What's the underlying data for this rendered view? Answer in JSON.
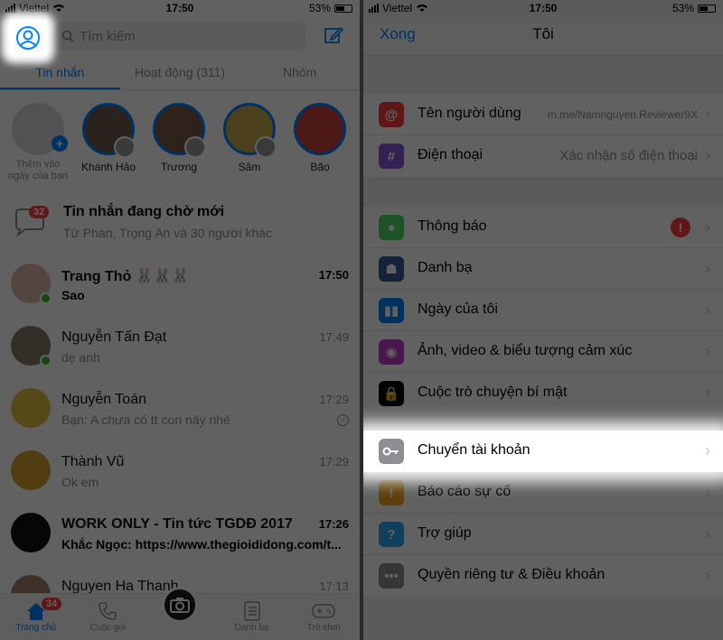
{
  "left": {
    "status": {
      "carrier": "Viettel",
      "time": "17:50",
      "battery": "53%"
    },
    "search": {
      "placeholder": "Tìm kiếm"
    },
    "tabs": [
      {
        "label": "Tin nhắn",
        "active": true
      },
      {
        "label": "Hoạt động (311)",
        "active": false
      },
      {
        "label": "Nhóm",
        "active": false
      }
    ],
    "stories": [
      {
        "label": "Thêm vào ngày của bạn",
        "add": true
      },
      {
        "label": "Khánh Hảo"
      },
      {
        "label": "Trương"
      },
      {
        "label": "Sâm"
      },
      {
        "label": "Bão"
      }
    ],
    "pending": {
      "badge": "32",
      "title": "Tin nhắn đang chờ mới",
      "subtitle": "Từ Phan, Trọng An và 30 người khác"
    },
    "conversations": [
      {
        "name": "Trang Thỏ 🐰🐰🐰",
        "message": "Sao",
        "time": "17:50",
        "unread": true,
        "online": true
      },
      {
        "name": "Nguyễn Tấn Đạt",
        "message": "dẹ anh",
        "time": "17:49",
        "unread": false,
        "online": true
      },
      {
        "name": "Nguyễn Toán",
        "message": "Bạn: A chưa có tt con này nhé",
        "time": "17:29",
        "unread": false,
        "online": false,
        "seen": true
      },
      {
        "name": "Thành Vũ",
        "message": "Ok em",
        "time": "17:29",
        "unread": false,
        "online": false
      },
      {
        "name": "WORK ONLY - Tin tức TGDĐ 2017",
        "message": "Khắc Ngọc: https://www.thegioididong.com/t...",
        "time": "17:26",
        "unread": true,
        "online": false
      },
      {
        "name": "Nguyen Ha Thanh",
        "message": "",
        "time": "17:13",
        "unread": false,
        "online": false
      }
    ],
    "tabbar": [
      {
        "label": "Trang chủ",
        "badge": "34",
        "active": true,
        "icon": "home-icon"
      },
      {
        "label": "Cuộc gọi",
        "icon": "phone-icon"
      },
      {
        "label": "",
        "icon": "camera-icon"
      },
      {
        "label": "Danh bạ",
        "icon": "contacts-icon"
      },
      {
        "label": "Trò chơi",
        "icon": "game-icon"
      }
    ]
  },
  "right": {
    "status": {
      "carrier": "Viettel",
      "time": "17:50",
      "battery": "53%"
    },
    "nav": {
      "done": "Xong",
      "title": "Tôi"
    },
    "group1": [
      {
        "label": "Tên người dùng",
        "value": "m.me/Namnguyen.Reviewer9X",
        "color": "#fa3e3e",
        "icon": "at-icon"
      },
      {
        "label": "Điện thoại",
        "value": "Xác nhận số điện thoại",
        "color": "#8a58d6",
        "icon": "hash-icon"
      }
    ],
    "group2": [
      {
        "label": "Thông báo",
        "alert": "!",
        "color": "#4cd964",
        "icon": "notification-icon"
      },
      {
        "label": "Danh bạ",
        "color": "#3b5998",
        "icon": "people-icon"
      },
      {
        "label": "Ngày của tôi",
        "color": "#0084ff",
        "icon": "day-icon"
      },
      {
        "label": "Ảnh, video & biểu tượng cảm xúc",
        "color": "#c43ac7",
        "icon": "camera-icon"
      },
      {
        "label": "Cuộc trò chuyện bí mật",
        "color": "#000000",
        "icon": "lock-icon"
      }
    ],
    "highlight": {
      "label": "Chuyển tài khoản",
      "color": "#8e8e93",
      "icon": "key-icon"
    },
    "group3": [
      {
        "label": "Báo cáo sự cố",
        "color": "#f5a623",
        "icon": "warning-icon"
      },
      {
        "label": "Trợ giúp",
        "color": "#2aa8f5",
        "icon": "help-icon"
      },
      {
        "label": "Quyền riêng tư & Điều khoản",
        "color": "#8e8e93",
        "icon": "more-icon"
      }
    ]
  }
}
